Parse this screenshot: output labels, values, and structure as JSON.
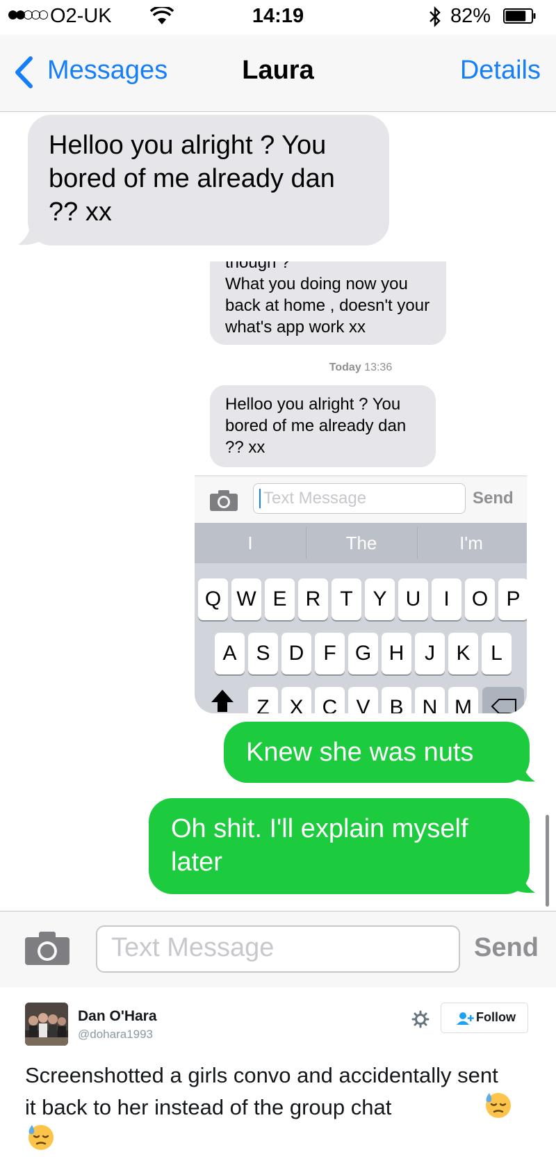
{
  "status_bar": {
    "signal": [
      true,
      true,
      false,
      false,
      false
    ],
    "carrier": "O2-UK",
    "wifi_icon": "wifi-icon",
    "time": "14:19",
    "bluetooth_icon": "bluetooth-icon",
    "battery_percent": "82%",
    "battery_level": 0.82
  },
  "nav": {
    "back_label": "Messages",
    "title": "Laura",
    "details_label": "Details"
  },
  "conversation": {
    "incoming": "Helloo you alright ? You bored of me already dan ?? xx",
    "outgoing": [
      "Knew she was nuts",
      "Oh shit. I'll explain myself later"
    ]
  },
  "embedded_screenshot": {
    "cut_text": "though ?",
    "message_1": "What you doing now you back at home , doesn't your what's app work xx",
    "timestamp_day": "Today",
    "timestamp_time": "13:36",
    "message_2": "Helloo you alright ? You bored of me already dan ?? xx",
    "input_placeholder": "Text Message",
    "send_label": "Send",
    "predictions": [
      "I",
      "The",
      "I'm"
    ],
    "keyboard_rows": [
      [
        "Q",
        "W",
        "E",
        "R",
        "T",
        "Y",
        "U",
        "I",
        "O",
        "P"
      ],
      [
        "A",
        "S",
        "D",
        "F",
        "G",
        "H",
        "J",
        "K",
        "L"
      ],
      [
        "Z",
        "X",
        "C",
        "V",
        "B",
        "N",
        "M"
      ]
    ]
  },
  "composer": {
    "placeholder": "Text Message",
    "send_label": "Send",
    "camera_icon": "camera-icon"
  },
  "tweet": {
    "name": "Dan O'Hara",
    "handle": "@dohara1993",
    "follow_label": "Follow",
    "text": "Screenshotted a girls convo and accidentally sent it back to her instead of the group chat",
    "emoji": "downcast-face-with-sweat-emoji"
  },
  "colors": {
    "ios_blue": "#147efb",
    "imessage_green": "#1dcb3f",
    "incoming_gray": "#e5e5ea"
  }
}
